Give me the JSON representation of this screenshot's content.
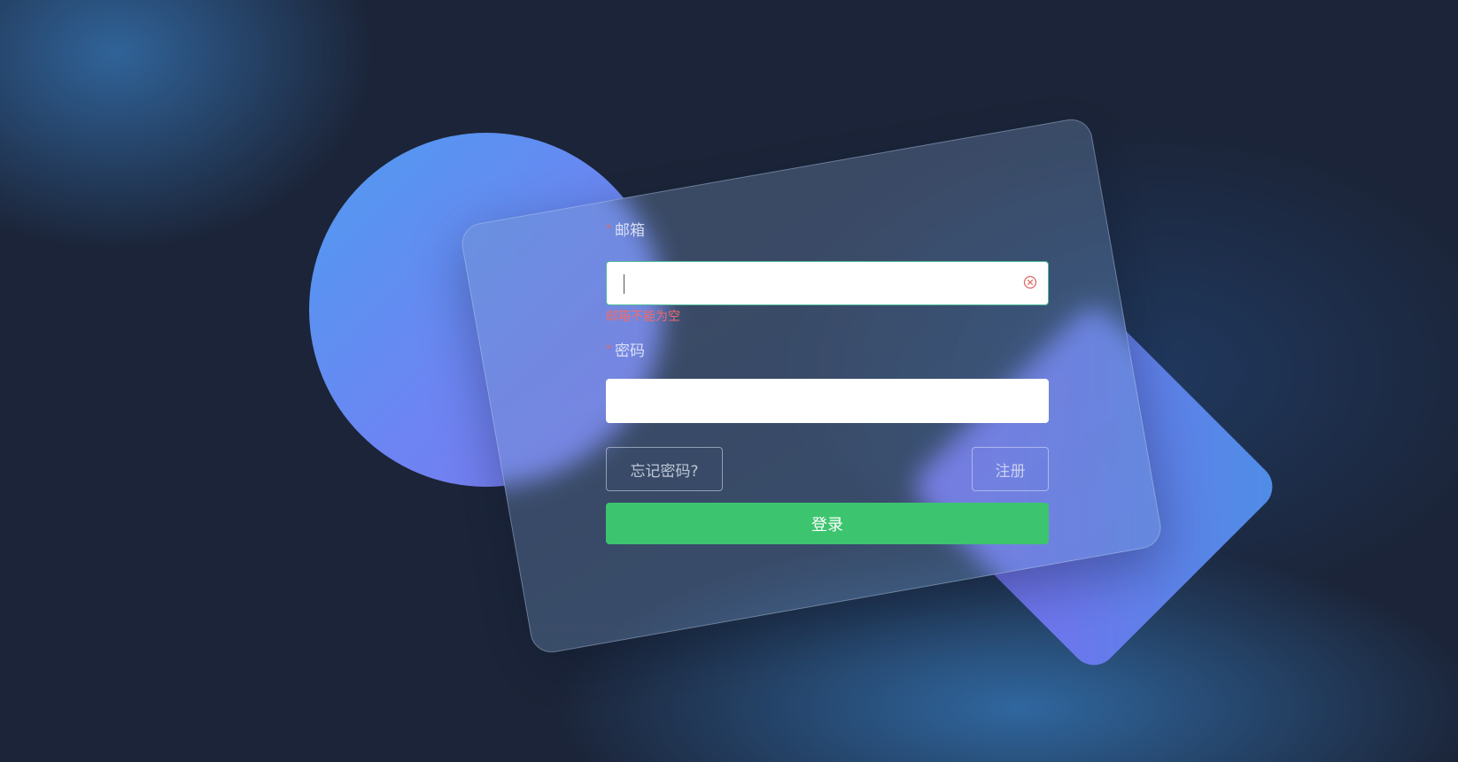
{
  "login_form": {
    "email": {
      "required_mark": "*",
      "label": "邮箱",
      "value": "",
      "placeholder": "",
      "error": "邮箱不能为空"
    },
    "password": {
      "required_mark": "*",
      "label": "密码",
      "value": "",
      "placeholder": ""
    },
    "forgot_label": "忘记密码?",
    "register_label": "注册",
    "login_label": "登录"
  },
  "colors": {
    "primary_button": "#3dc46f",
    "error": "#ee6b6b",
    "focus_border": "#4dbb9a",
    "background": "#1b2438"
  },
  "icons": {
    "email_clear": "circle-x-icon"
  }
}
